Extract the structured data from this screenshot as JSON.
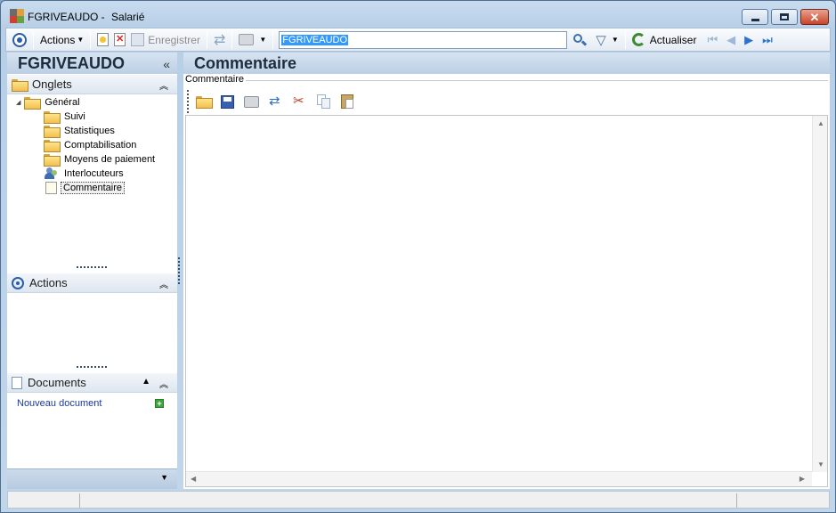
{
  "window": {
    "title_name": "FGRIVEAUDO -",
    "title_type": "Salarié"
  },
  "toolbar": {
    "actions_label": "Actions",
    "save_label": "Enregistrer",
    "search_value": "FGRIVEAUDO",
    "refresh_label": "Actualiser"
  },
  "left": {
    "header": "FGRIVEAUDO",
    "collapse_glyph": "«",
    "onglets_label": "Onglets",
    "tree": {
      "root": "Général",
      "items": [
        "Suivi",
        "Statistiques",
        "Comptabilisation",
        "Moyens de paiement",
        "Interlocuteurs",
        "Commentaire"
      ]
    },
    "actions_label": "Actions",
    "documents_label": "Documents",
    "new_document": "Nouveau document"
  },
  "main": {
    "header": "Commentaire",
    "group_label": "Commentaire"
  },
  "colors": {
    "accent": "#1f4e8c",
    "selection": "#3399ff"
  }
}
